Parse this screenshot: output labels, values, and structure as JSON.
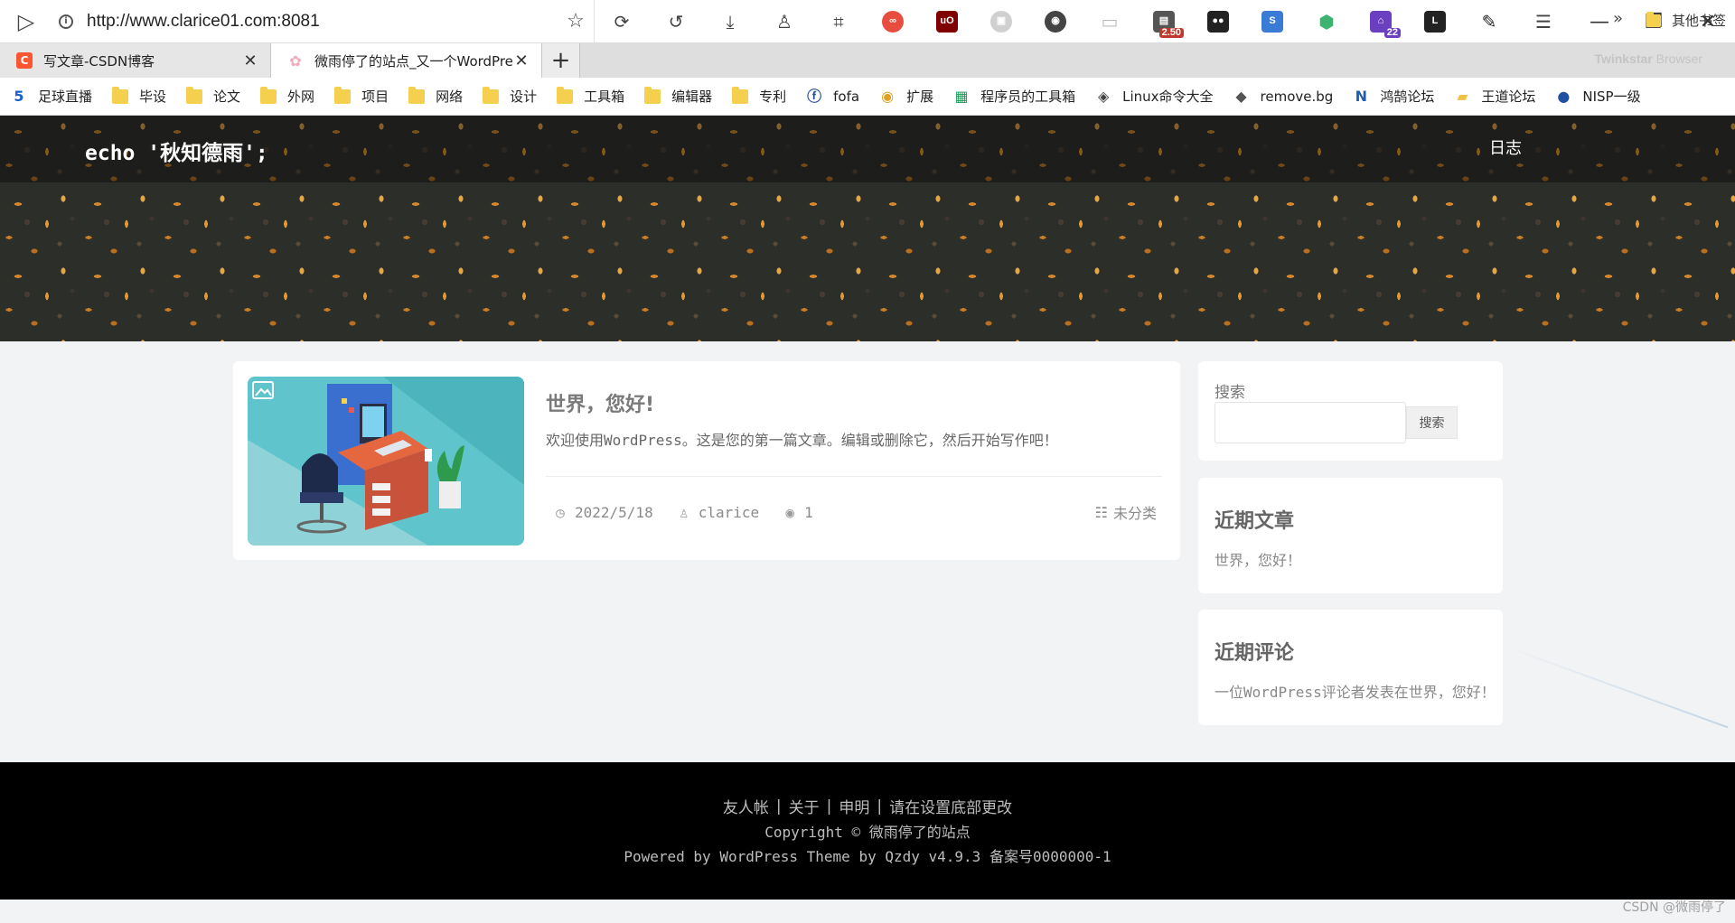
{
  "browser": {
    "url": "http://www.clarice01.com:8081",
    "brand_name": "Twinkstar",
    "brand_suffix": " Browser",
    "ext_badges": {
      "counter": "2.50",
      "notifications": "22"
    },
    "tabs": [
      {
        "label": "写文章-CSDN博客",
        "favicon": "csdn-icon",
        "favicon_color": "#fc5531",
        "active": false
      },
      {
        "label": "微雨停了的站点_又一个WordPress站点",
        "favicon": "blossom-icon",
        "favicon_color": "#f3a9b8",
        "active": true
      }
    ],
    "bookmarks": [
      {
        "label": "足球直播",
        "icon": "number-five-icon"
      },
      {
        "label": "毕设",
        "icon": "folder-icon"
      },
      {
        "label": "论文",
        "icon": "folder-icon"
      },
      {
        "label": "外网",
        "icon": "folder-icon"
      },
      {
        "label": "项目",
        "icon": "folder-icon"
      },
      {
        "label": "网络",
        "icon": "folder-icon"
      },
      {
        "label": "设计",
        "icon": "folder-icon"
      },
      {
        "label": "工具箱",
        "icon": "folder-icon"
      },
      {
        "label": "编辑器",
        "icon": "folder-icon"
      },
      {
        "label": "专利",
        "icon": "folder-icon"
      },
      {
        "label": "fofa",
        "icon": "fofa-icon"
      },
      {
        "label": "扩展",
        "icon": "chrome-icon"
      },
      {
        "label": "程序员的工具箱",
        "icon": "toolbox-icon"
      },
      {
        "label": "Linux命令大全",
        "icon": "linux-icon"
      },
      {
        "label": "remove.bg",
        "icon": "removebg-icon"
      },
      {
        "label": "鸿鹄论坛",
        "icon": "honghu-icon"
      },
      {
        "label": "王道论坛",
        "icon": "wangdao-icon"
      },
      {
        "label": "NISP一级",
        "icon": "nisp-icon"
      }
    ],
    "other_bookmarks": "其他书签"
  },
  "site": {
    "title": "echo '秋知德雨';",
    "nav_log": "日志"
  },
  "post": {
    "title": "世界，您好!",
    "excerpt": "欢迎使用WordPress。这是您的第一篇文章。编辑或删除它，然后开始写作吧！",
    "date": "2022/5/18",
    "author": "clarice",
    "views": "1",
    "category": "未分类"
  },
  "sidebar": {
    "search_label": "搜索",
    "search_value": "",
    "search_button": "搜索",
    "recent_posts_title": "近期文章",
    "recent_post": "世界，您好！",
    "recent_comments_title": "近期评论",
    "recent_comment": "一位WordPress评论者发表在世界，您好！"
  },
  "footer": {
    "links": [
      "友人帐",
      "关于",
      "申明",
      "请在设置底部更改"
    ],
    "copyright": "Copyright © 微雨停了的站点",
    "powered": "Powered by WordPress Theme by Qzdy v4.9.3 备案号0000000-1"
  },
  "watermark": "CSDN @微雨停了",
  "colors": {
    "footer_bg": "#000000",
    "page_bg": "#f2f3f5",
    "card_bg": "#ffffff",
    "csdn_red": "#fc5531"
  }
}
